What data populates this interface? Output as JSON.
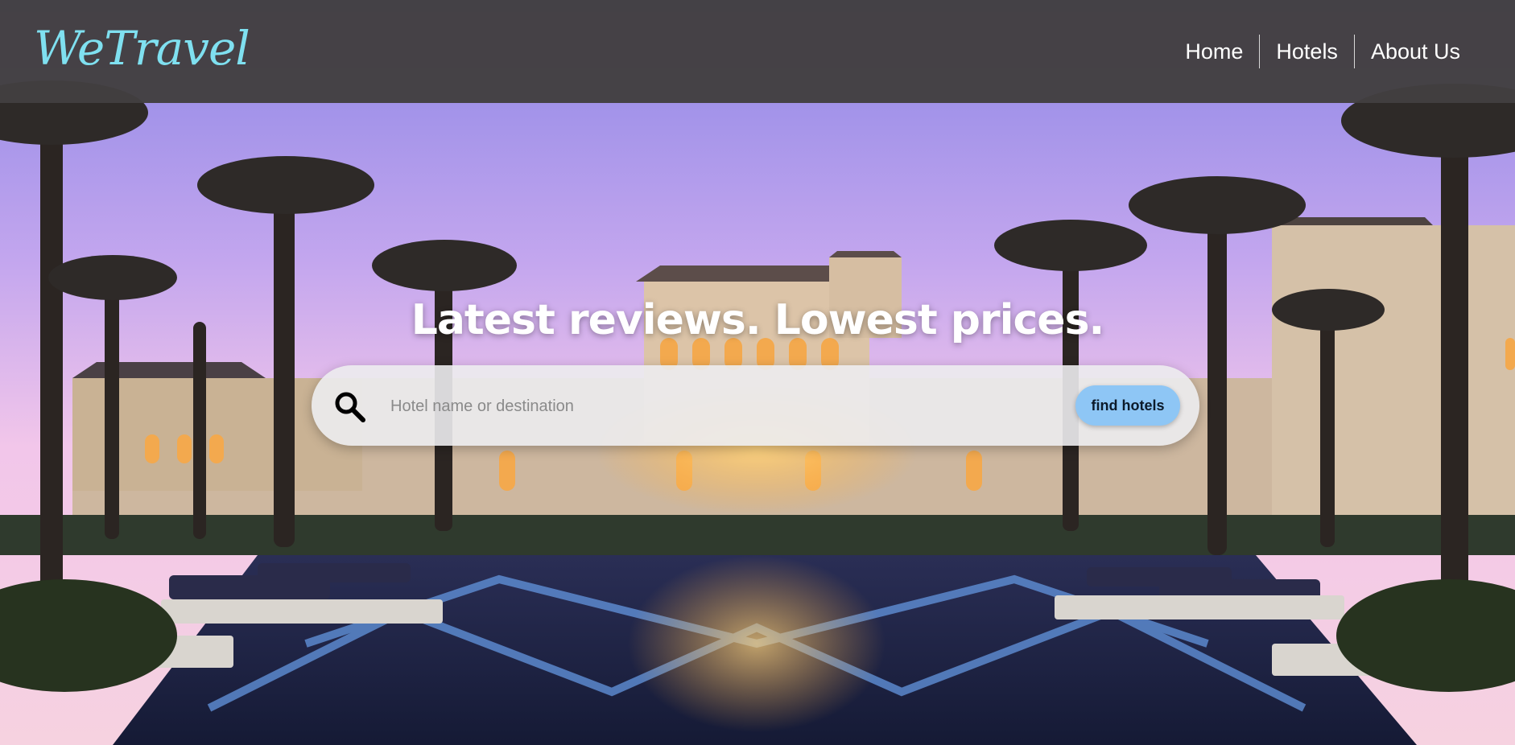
{
  "brand": {
    "logo": "WeTravel",
    "accent_color": "#7fe0f0"
  },
  "nav": {
    "items": [
      {
        "label": "Home"
      },
      {
        "label": "Hotels"
      },
      {
        "label": "About Us"
      }
    ]
  },
  "hero": {
    "headline": "Latest reviews. Lowest prices.",
    "background": "resort-pool-at-dusk-with-palm-trees"
  },
  "search": {
    "placeholder": "Hotel name or destination",
    "value": "",
    "icon": "search-icon",
    "button_label": "find hotels",
    "button_color": "#8ec6f5"
  }
}
